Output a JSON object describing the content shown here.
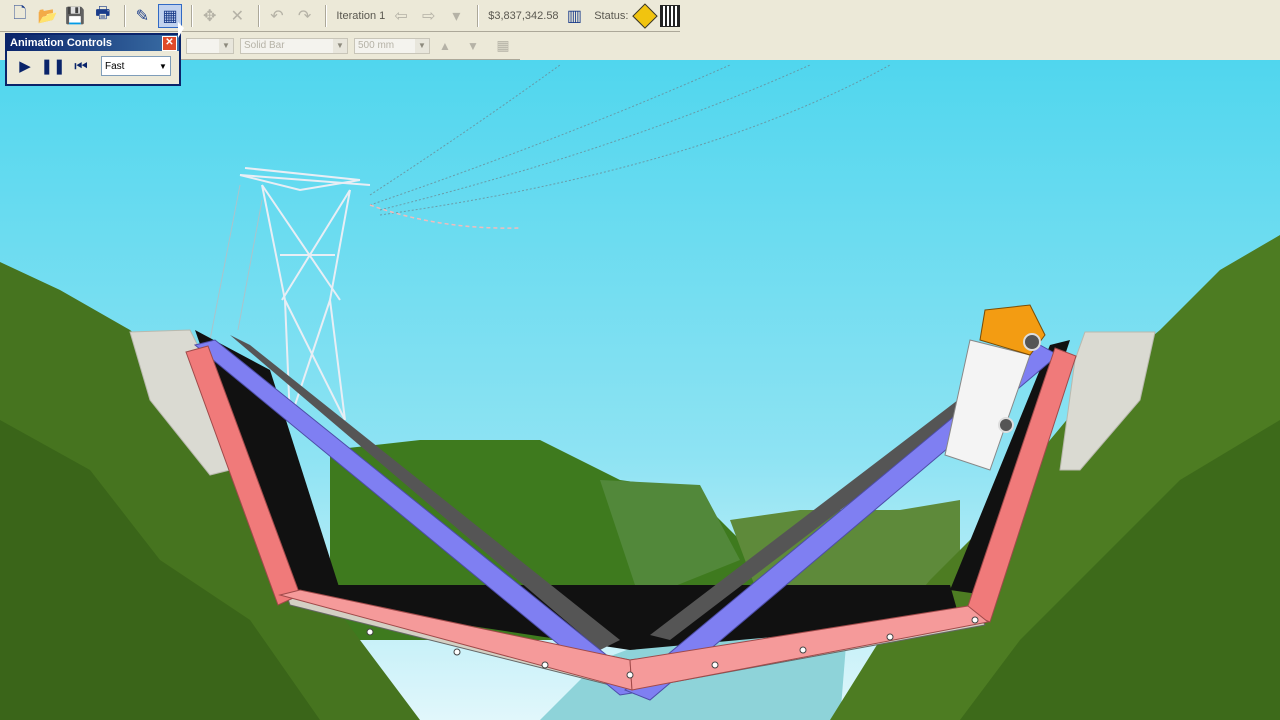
{
  "toolbar": {
    "buttons": [
      "new-icon",
      "open-icon",
      "save-icon",
      "print-icon",
      "draw-icon",
      "animation-icon",
      "select-icon",
      "delete-icon",
      "undo-icon",
      "redo-icon"
    ],
    "iteration_label": "Iteration 1",
    "cost": "$3,837,342.58",
    "status_label": "Status:"
  },
  "member_toolbar": {
    "material": "Solid Bar",
    "size": "500 mm"
  },
  "animation_controls": {
    "title": "Animation Controls",
    "close": "✕",
    "speed": "Fast"
  },
  "colors": {
    "sky_top": "#5ad7ee",
    "sky_bottom": "#d9f6fb",
    "hill_green": "#3f6e17",
    "member_compression": "#f07a7a",
    "member_tension": "#7f7ff2",
    "deck": "#d8d4c8",
    "truck": "#f39c12"
  }
}
